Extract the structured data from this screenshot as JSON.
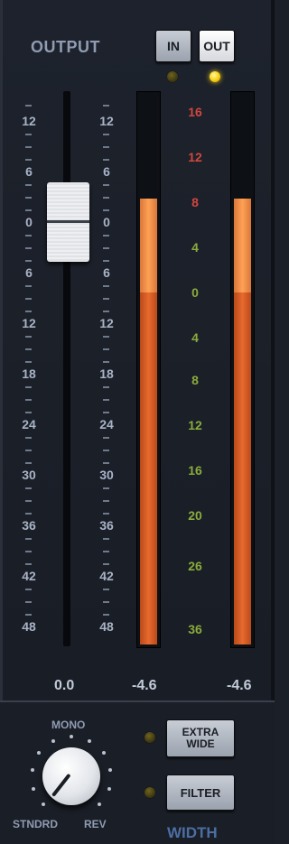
{
  "title": "OUTPUT",
  "buttons": {
    "in": "IN",
    "out": "OUT"
  },
  "leds": {
    "in": "off",
    "out": "on"
  },
  "fader_scale": [
    "12",
    "6",
    "0",
    "6",
    "12",
    "18",
    "24",
    "30",
    "36",
    "42",
    "48"
  ],
  "meter_scale": [
    {
      "label": "16",
      "color": "#d0473f"
    },
    {
      "label": "12",
      "color": "#d0473f"
    },
    {
      "label": "8",
      "color": "#d0473f"
    },
    {
      "label": "4",
      "color": "#8bab3c"
    },
    {
      "label": "0",
      "color": "#8bab3c"
    },
    {
      "label": "4",
      "color": "#8bab3c"
    },
    {
      "label": "8",
      "color": "#8bab3c"
    },
    {
      "label": "12",
      "color": "#8bab3c"
    },
    {
      "label": "16",
      "color": "#8bab3c"
    },
    {
      "label": "20",
      "color": "#8bab3c"
    },
    {
      "label": "26",
      "color": "#8bab3c"
    },
    {
      "label": "36",
      "color": "#8bab3c"
    }
  ],
  "fader_value": "0.0",
  "meter_left_value": "-4.6",
  "meter_right_value": "-4.6",
  "knob_labels": {
    "mono": "MONO",
    "stndrd": "STNDRD",
    "rev": "REV"
  },
  "width_buttons": {
    "extra_wide": "EXTRA WIDE",
    "filter": "FILTER"
  },
  "width_title": "WIDTH",
  "colors": {
    "accent_blue": "#4c6ea3",
    "meter_orange": "#e86a2e"
  }
}
